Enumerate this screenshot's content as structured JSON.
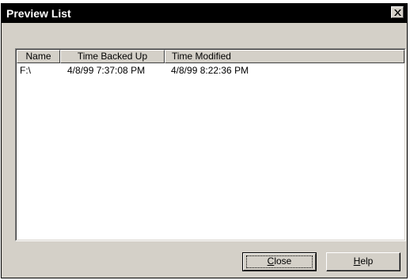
{
  "window": {
    "title": "Preview List"
  },
  "list": {
    "columns": [
      "Name",
      "Time Backed Up",
      "Time Modified"
    ],
    "rows": [
      {
        "name": "F:\\",
        "time_backed_up": "4/8/99 7:37:08 PM",
        "time_modified": "4/8/99 8:22:36 PM"
      }
    ]
  },
  "buttons": {
    "close": {
      "mnemonic": "C",
      "rest": "lose"
    },
    "help": {
      "mnemonic": "H",
      "rest": "elp"
    }
  },
  "icons": {
    "close": "close-x-icon"
  },
  "colors": {
    "face": "#d4d0c8",
    "titlebar": "#000000",
    "list_bg": "#ffffff"
  }
}
